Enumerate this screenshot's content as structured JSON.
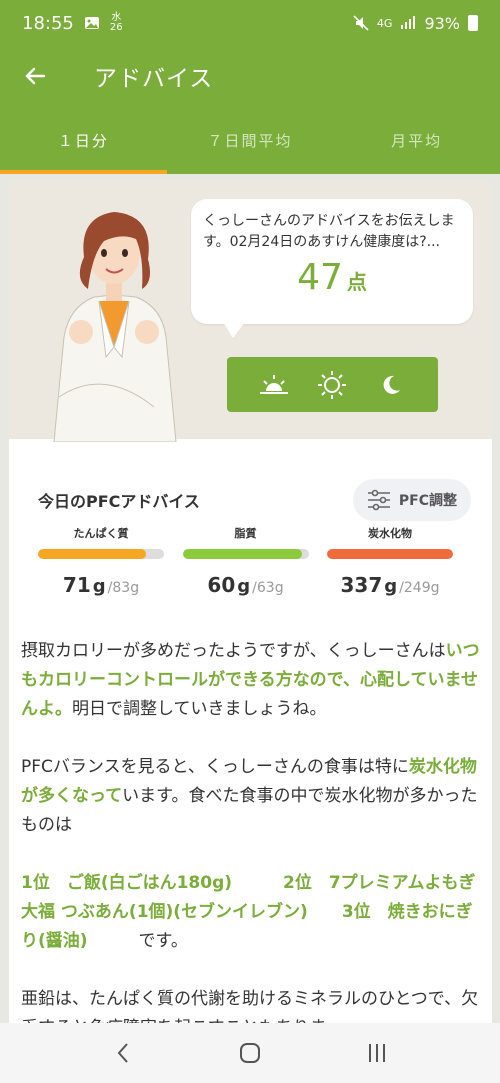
{
  "status_bar": {
    "time": "18:55",
    "date_top": "水",
    "date_bottom": "26",
    "signal": "4G",
    "battery": "93%"
  },
  "app_bar": {
    "title": "アドバイス",
    "back_icon": "arrow-left-icon"
  },
  "tabs": [
    {
      "label": "１日分",
      "active": true
    },
    {
      "label": "７日間平均",
      "active": false
    },
    {
      "label": "月平均",
      "active": false
    }
  ],
  "advice_bubble": {
    "message": "くっしーさんのアドバイスをお伝えします。02月24日のあすけん健康度は?...",
    "score": "47",
    "score_unit": "点"
  },
  "time_icons": [
    "sunrise-icon",
    "sun-icon",
    "moon-icon"
  ],
  "pfc": {
    "title": "今日のPFCアドバイス",
    "adjust_button": "PFC調整",
    "nutrients": [
      {
        "label": "たんぱく質",
        "value": "71",
        "unit": "g",
        "target": "/83g",
        "color": "#f5a623",
        "progress": 0.86
      },
      {
        "label": "脂質",
        "value": "60",
        "unit": "g",
        "target": "/63g",
        "color": "#8ccc3c",
        "progress": 0.95
      },
      {
        "label": "炭水化物",
        "value": "337",
        "unit": "g",
        "target": "/249g",
        "color": "#f06a3a",
        "progress": 1.0
      }
    ]
  },
  "advice": {
    "p1_a": "摂取カロリーが多めだったようですが、くっしーさんは",
    "p1_hl": "いつもカロリーコントロールができる方なので、心配していませんよ。",
    "p1_b": "明日で調整していきましょうね。",
    "p2_a": "PFCバランスを見ると、くっしーさんの食事は特に",
    "p2_hl": "炭水化物が多くなって",
    "p2_b": "います。食べた食事の中で炭水化物が多かったものは",
    "p3_hl": "1位　ご飯(白ごはん180g)　　　2位　7プレミアムよもぎ大福 つぶあん(1個)(セブンイレブン)　　3位　焼きおにぎり(醤油)",
    "p3_b": "　　　です。",
    "p4": "亜鉛は、たんぱく質の代謝を助けるミネラルのひとつで、欠乏すると免疫障害を起こすこともありま"
  },
  "navbar": [
    "back-nav-icon",
    "home-nav-icon",
    "recents-nav-icon"
  ]
}
